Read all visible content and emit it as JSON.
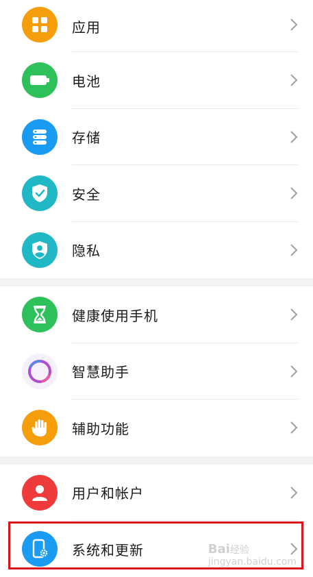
{
  "colors": {
    "apps": "#f59d0b",
    "battery": "#2ec05a",
    "storage": "#1a9bf2",
    "security": "#21b8c6",
    "privacy": "#21b8c6",
    "digital_balance": "#2ec05a",
    "assistant_ring": "#b04ccf",
    "accessibility": "#f59d0b",
    "users": "#ef3b3b",
    "system": "#1a9bf2",
    "highlight": "#d9151c"
  },
  "settings": {
    "group1": [
      {
        "label": "应用",
        "icon": "apps-grid-icon"
      },
      {
        "label": "电池",
        "icon": "battery-icon"
      },
      {
        "label": "存储",
        "icon": "storage-icon"
      },
      {
        "label": "安全",
        "icon": "security-shield-icon"
      },
      {
        "label": "隐私",
        "icon": "privacy-shield-user-icon"
      }
    ],
    "group2": [
      {
        "label": "健康使用手机",
        "icon": "hourglass-icon"
      },
      {
        "label": "智慧助手",
        "icon": "assistant-ring-icon"
      },
      {
        "label": "辅助功能",
        "icon": "hand-icon"
      }
    ],
    "group3": [
      {
        "label": "用户和帐户",
        "icon": "user-icon"
      },
      {
        "label": "系统和更新",
        "icon": "phone-gear-icon"
      }
    ]
  },
  "watermark": {
    "logo": "Bai",
    "logo2": "经验",
    "url": "jingyan.baidu.com"
  }
}
